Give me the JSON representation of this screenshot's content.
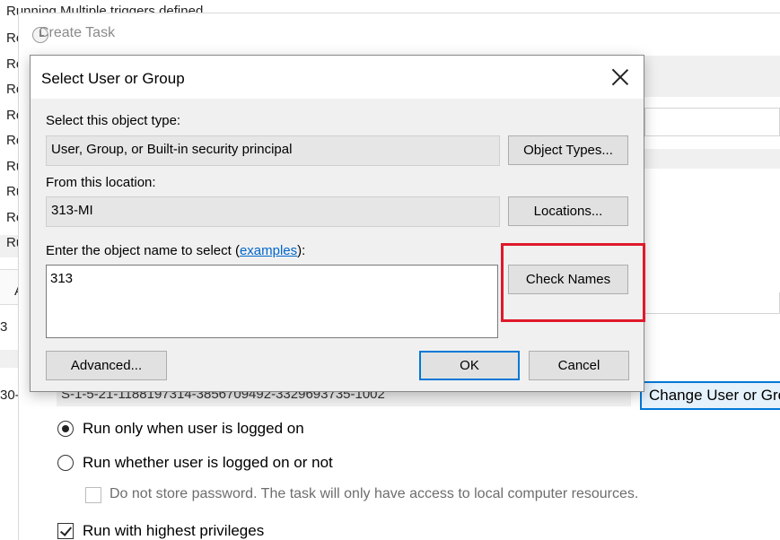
{
  "background": {
    "top_text": "Running Multiple triggers defined",
    "rows": [
      "Re",
      "Re",
      "Re",
      "Re",
      "Re",
      "Ru",
      "Ru",
      "Re",
      "Ru"
    ],
    "left_snippets": [
      "A",
      "3",
      "30-"
    ]
  },
  "create_task": {
    "title": "Create Task",
    "icon": "clock-icon",
    "sid": "S-1-5-21-1188197314-3856709492-3329693735-1002",
    "change_user_label": "Change User or Gro",
    "options": {
      "run_logged_on": "Run only when user is logged on",
      "run_whether": "Run whether user is logged on or not",
      "no_store_password": "Do not store password.  The task will only have access to local computer resources.",
      "highest_privileges": "Run with highest privileges"
    }
  },
  "dialog": {
    "title": "Select User or Group",
    "object_type_label": "Select this object type:",
    "object_type_value": "User, Group, or Built-in security principal",
    "object_types_button": "Object Types...",
    "location_label": "From this location:",
    "location_value": "313-MI",
    "locations_button": "Locations...",
    "enter_name_label": "Enter the object name to select (",
    "examples_link": "examples",
    "enter_name_suffix": "):",
    "name_value": "313",
    "check_names_button": "Check Names",
    "advanced_button": "Advanced...",
    "ok_button": "OK",
    "cancel_button": "Cancel"
  },
  "colors": {
    "highlight": "#e0182b",
    "accent": "#0078d7",
    "link": "#0066cc"
  }
}
